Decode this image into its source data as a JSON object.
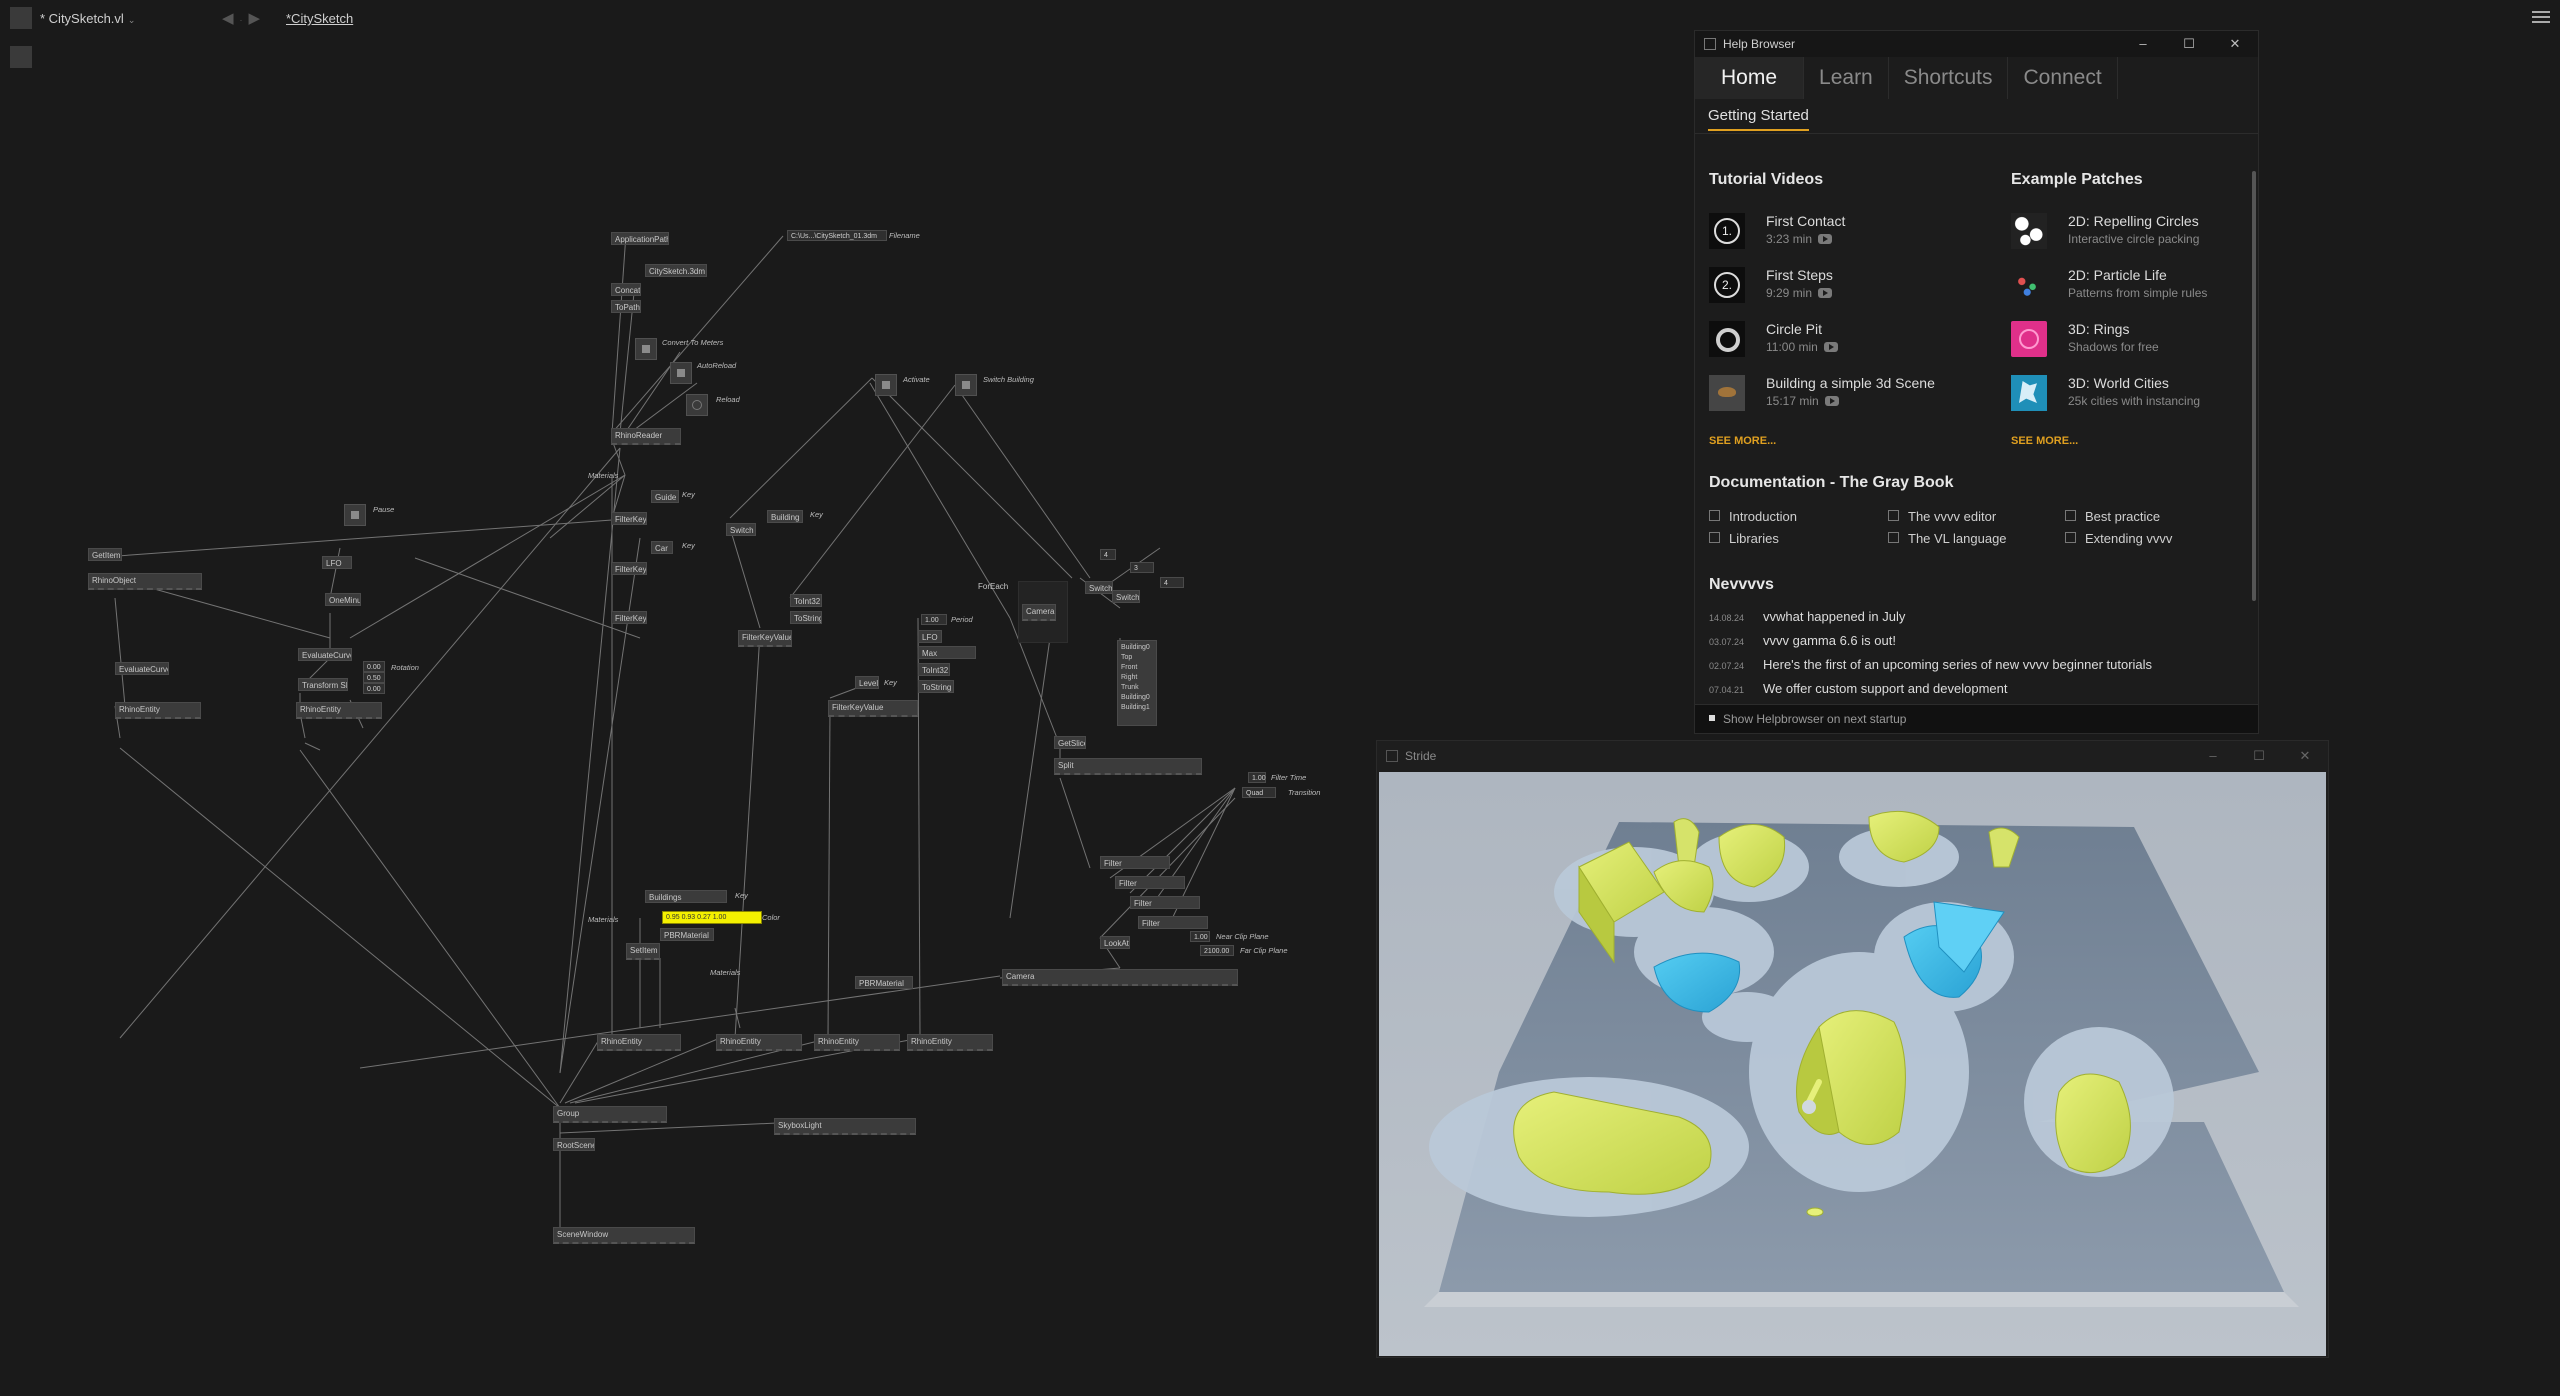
{
  "topbar": {
    "doc_tab": "* CitySketch.vl",
    "breadcrumb": "*CitySketch"
  },
  "patch": {
    "nodes": [
      {
        "id": "n1",
        "label": "ApplicationPath"
      },
      {
        "id": "n2",
        "label": "CitySketch.3dm"
      },
      {
        "id": "n3",
        "label": "Concat"
      },
      {
        "id": "n4",
        "label": "ToPath"
      },
      {
        "id": "n5",
        "label": "C:\\Us...\\CitySketch_01.3dm"
      },
      {
        "id": "n6",
        "label": "RhinoReader"
      },
      {
        "id": "n7",
        "label": "Guide"
      },
      {
        "id": "n8",
        "label": "Car"
      },
      {
        "id": "n9",
        "label": "FilterKey"
      },
      {
        "id": "n10",
        "label": "FilterKey"
      },
      {
        "id": "n11",
        "label": "FilterKey"
      },
      {
        "id": "n12",
        "label": "Switch"
      },
      {
        "id": "n13",
        "label": "Building"
      },
      {
        "id": "n14",
        "label": "FilterKeyValue"
      },
      {
        "id": "n15",
        "label": "ToInt32"
      },
      {
        "id": "n16",
        "label": "ToString"
      },
      {
        "id": "n17",
        "label": "Level"
      },
      {
        "id": "n18",
        "label": "FilterKeyValue"
      },
      {
        "id": "n19",
        "label": "LFO"
      },
      {
        "id": "n20",
        "label": "Max"
      },
      {
        "id": "n21",
        "label": "ToInt32"
      },
      {
        "id": "n22",
        "label": "ToString"
      },
      {
        "id": "n23",
        "label": "ForEach"
      },
      {
        "id": "n24",
        "label": "Camera"
      },
      {
        "id": "n25",
        "label": "Switch"
      },
      {
        "id": "n26",
        "label": "Switch"
      },
      {
        "id": "n27",
        "label": "GetSlice"
      },
      {
        "id": "n28",
        "label": "Split"
      },
      {
        "id": "n29",
        "label": "Filter"
      },
      {
        "id": "n30",
        "label": "Filter"
      },
      {
        "id": "n31",
        "label": "Filter"
      },
      {
        "id": "n32",
        "label": "Filter"
      },
      {
        "id": "n33",
        "label": "LookAt"
      },
      {
        "id": "n34",
        "label": "Camera"
      },
      {
        "id": "n35",
        "label": "Quad"
      },
      {
        "id": "n36",
        "label": "GetItem"
      },
      {
        "id": "n37",
        "label": "RhinoObject"
      },
      {
        "id": "n38",
        "label": "LFO"
      },
      {
        "id": "n39",
        "label": "OneMinus"
      },
      {
        "id": "n40",
        "label": "EvaluateCurve"
      },
      {
        "id": "n41",
        "label": "Transform SRT"
      },
      {
        "id": "n42",
        "label": "EvaluateCurve"
      },
      {
        "id": "n43",
        "label": "RhinoEntity"
      },
      {
        "id": "n44",
        "label": "RhinoEntity"
      },
      {
        "id": "n45",
        "label": "Buildings"
      },
      {
        "id": "n46",
        "label": "PBRMaterial"
      },
      {
        "id": "n47",
        "label": "SetItem"
      },
      {
        "id": "n48",
        "label": "RhinoEntity"
      },
      {
        "id": "n49",
        "label": "RhinoEntity"
      },
      {
        "id": "n50",
        "label": "RhinoEntity"
      },
      {
        "id": "n51",
        "label": "RhinoEntity"
      },
      {
        "id": "n52",
        "label": "PBRMaterial"
      },
      {
        "id": "n53",
        "label": "Group"
      },
      {
        "id": "n54",
        "label": "SkyboxLight"
      },
      {
        "id": "n55",
        "label": "RootScene"
      },
      {
        "id": "n56",
        "label": "SceneWindow"
      }
    ],
    "labels": {
      "filename": "Filename",
      "convert": "Convert To Meters",
      "autoreload": "AutoReload",
      "reload": "Reload",
      "activate": "Activate",
      "switch_building": "Switch Building",
      "materials1": "Materials",
      "key1": "Key",
      "key2": "Key",
      "key3": "Key",
      "key4": "Key",
      "key5": "Key",
      "pause": "Pause",
      "rotation": "Rotation",
      "period": "Period",
      "filter_time": "Filter Time",
      "transition": "Transition",
      "near_clip": "Near Clip Plane",
      "far_clip": "Far Clip Plane",
      "color": "Color",
      "materials2": "Materials",
      "materials3": "Materials"
    },
    "values": {
      "period": "1.00",
      "filter_time": "1.00",
      "quad": "Quad",
      "near": "1.00",
      "far": "2100.00",
      "rot1": "0.00",
      "rot2": "0.50",
      "rot3": "0.00",
      "sw1": "4",
      "sw2": "3",
      "sw3": "4",
      "color_value": "0.95 0.93 0.27 1.00"
    },
    "building_list": [
      "Building0",
      "Top",
      "Front",
      "Right",
      "Trunk",
      "Building0",
      "Building1"
    ]
  },
  "help": {
    "title": "Help Browser",
    "tabs": [
      "Home",
      "Learn",
      "Shortcuts",
      "Connect"
    ],
    "subtab": "Getting Started",
    "tutorial_head": "Tutorial Videos",
    "tutorials": [
      {
        "title": "First Contact",
        "meta": "3:23 min"
      },
      {
        "title": "First Steps",
        "meta": "9:29 min"
      },
      {
        "title": "Circle Pit",
        "meta": "11:00 min"
      },
      {
        "title": "Building a simple 3d Scene",
        "meta": "15:17 min"
      }
    ],
    "tutorial_nums": [
      "1.",
      "2."
    ],
    "examples_head": "Example Patches",
    "examples": [
      {
        "title": "2D: Repelling Circles",
        "sub": "Interactive circle packing"
      },
      {
        "title": "2D: Particle Life",
        "sub": "Patterns from simple rules"
      },
      {
        "title": "3D: Rings",
        "sub": "Shadows for free"
      },
      {
        "title": "3D: World Cities",
        "sub": "25k cities with instancing"
      }
    ],
    "see_more": "SEE MORE...",
    "doc_head": "Documentation - The Gray Book",
    "docs": [
      "Introduction",
      "The vvvv editor",
      "Best practice",
      "Libraries",
      "The VL language",
      "Extending vvvv"
    ],
    "news_head": "Nevvvvs",
    "news": [
      {
        "date": "14.08.24",
        "text": "vvwhat happened in July"
      },
      {
        "date": "03.07.24",
        "text": "vvvv gamma 6.6 is out!"
      },
      {
        "date": "02.07.24",
        "text": "Here's the first of an upcoming series of new vvvv beginner tutorials"
      },
      {
        "date": "07.04.21",
        "text": "We offer custom support and development"
      }
    ],
    "footer": "Show Helpbrowser on next startup"
  },
  "stride": {
    "title": "Stride"
  },
  "colors": {
    "background": "#1a1a1a",
    "accent_orange": "#e0a020",
    "building_yellow": "#d8e86a",
    "building_blue": "#3ab8e8",
    "iobox_yellow": "#f4f000"
  }
}
